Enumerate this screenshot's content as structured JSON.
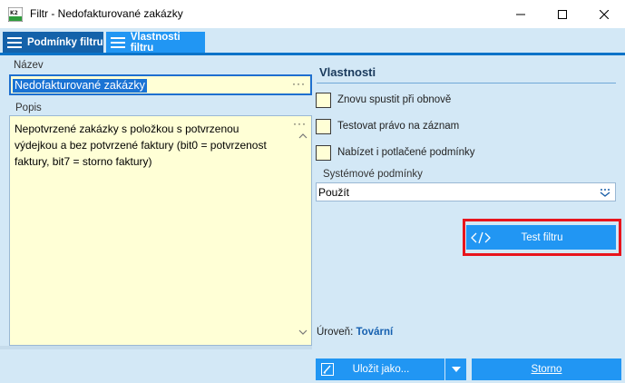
{
  "window": {
    "title": "Filtr - Nedofakturované zakázky",
    "app_icon": "k2-app-icon",
    "controls": {
      "minimize": "minimize-icon",
      "maximize": "maximize-icon",
      "close": "close-icon"
    }
  },
  "tabs": [
    {
      "label": "Podmínky filtru",
      "icon": "hamburger-icon",
      "active": false
    },
    {
      "label": "Vlastnosti filtru",
      "icon": "hamburger-icon",
      "active": true
    }
  ],
  "form": {
    "nazev_label": "Název",
    "nazev_value": "Nedofakturované zakázky",
    "ellipsis": "···",
    "popis_label": "Popis",
    "popis_value": "Nepotvrzené zakázky s položkou s potvrzenou výdejkou a bez potvrzené faktury (bit0 = potvrzenost faktury, bit7 = storno faktury)"
  },
  "properties": {
    "title": "Vlastnosti",
    "checkboxes": [
      {
        "label": "Znovu spustit při obnově",
        "checked": false
      },
      {
        "label": "Testovat právo na záznam",
        "checked": false
      },
      {
        "label": "Nabízet i potlačené podmínky",
        "checked": false
      }
    ],
    "system_label": "Systémové podmínky",
    "system_value": "Použít",
    "test_button": "Test filtru",
    "level_label": "Úroveň:",
    "level_value": "Tovární"
  },
  "footer": {
    "save_label": "Uložit jako...",
    "cancel_label": "Storno"
  },
  "colors": {
    "accent": "#2196f3",
    "tab_inactive": "#1462aa",
    "panel_bg": "#d3e8f6",
    "field_bg": "#ffffd6",
    "highlight_outline": "#e8141c"
  }
}
